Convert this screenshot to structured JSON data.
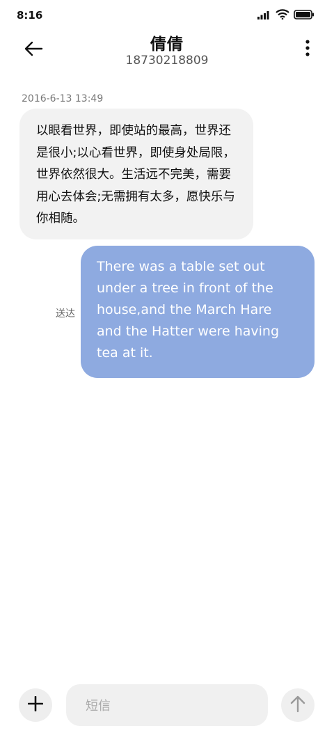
{
  "status_bar": {
    "time": "8:16",
    "icons": [
      "signal-icon",
      "wifi-icon",
      "battery-icon"
    ]
  },
  "header": {
    "contact_name": "倩倩",
    "contact_number": "18730218809",
    "back_icon": "arrow-left-icon",
    "more_icon": "more-vertical-icon"
  },
  "messages": {
    "timestamp": "2016-6-13 13:49",
    "incoming": {
      "text": "以眼看世界，即使站的最高，世界还是很小;以心看世界，即使身处局限，世界依然很大。生活远不完美，需要用心去体会;无需拥有太多，愿快乐与你相随。"
    },
    "outgoing": {
      "text": "There was a table set out under a tree in front of the house,and the March Hare and the Hatter were having tea at it.",
      "status": "送达"
    }
  },
  "input_bar": {
    "placeholder": "短信",
    "add_icon": "plus-icon",
    "send_icon": "arrow-up-icon"
  },
  "colors": {
    "outgoing_bubble": "#8eaae0",
    "incoming_bubble": "#f2f2f2"
  }
}
